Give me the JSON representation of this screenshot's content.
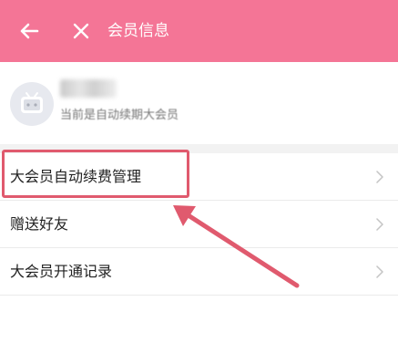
{
  "header": {
    "title": "会员信息",
    "color": "#f47596"
  },
  "account": {
    "status_text": "当前是自动续期大会员"
  },
  "menu": {
    "items": [
      {
        "label": "大会员自动续费管理"
      },
      {
        "label": "赠送好友"
      },
      {
        "label": "大会员开通记录"
      },
      {
        "label": ""
      }
    ]
  },
  "annotation": {
    "color": "#e05a6e",
    "target": "大会员自动续费管理"
  },
  "icons": {
    "back": "back-arrow-icon",
    "close": "close-icon",
    "avatar": "tv-avatar-icon",
    "chevron": "chevron-right-icon"
  }
}
